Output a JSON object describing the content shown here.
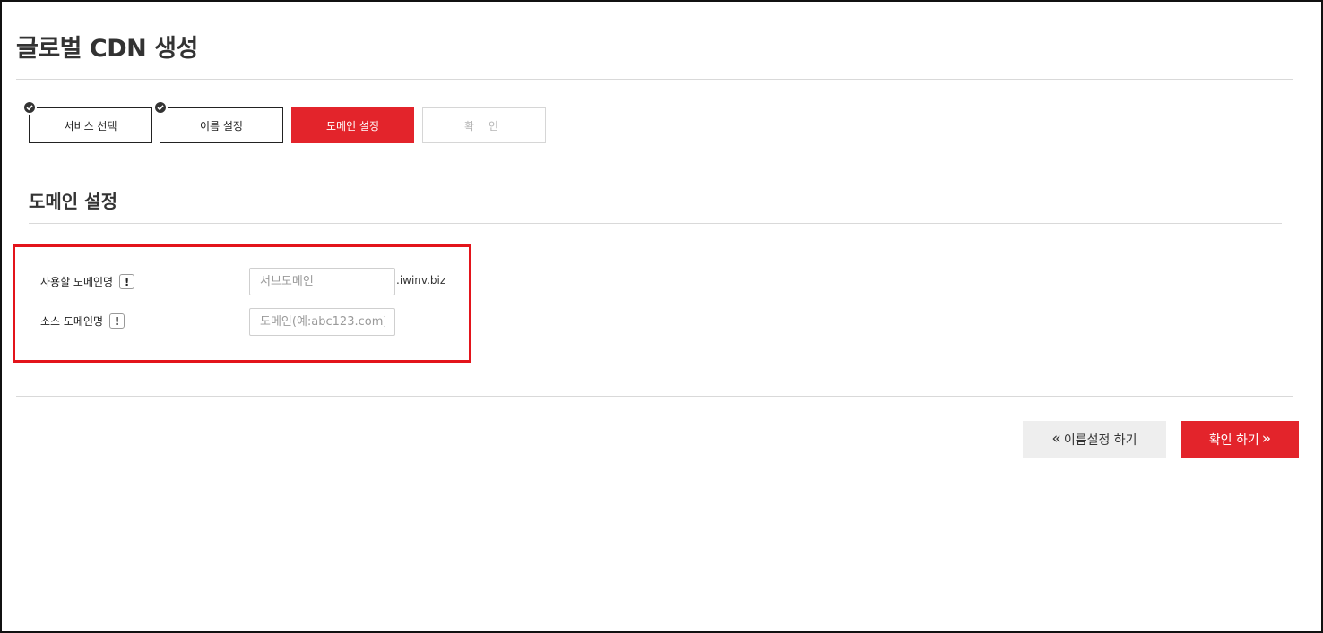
{
  "page": {
    "title": "글로벌 CDN 생성"
  },
  "steps": [
    {
      "label": "서비스 선택",
      "state": "done"
    },
    {
      "label": "이름 설정",
      "state": "done"
    },
    {
      "label": "도메인 설정",
      "state": "active"
    },
    {
      "label": "확 인",
      "state": "pending"
    }
  ],
  "section": {
    "title": "도메인 설정"
  },
  "form": {
    "domain_label": "사용할 도메인명",
    "domain_placeholder": "서브도메인",
    "domain_value": "",
    "domain_suffix": ".iwinv.biz",
    "source_label": "소스 도메인명",
    "source_placeholder": "도메인(예:abc123.com)",
    "source_value": "",
    "info_glyph": "!"
  },
  "actions": {
    "prev_label": "이름설정 하기",
    "next_label": "확인 하기",
    "prev_chevron": "«",
    "next_chevron": "»"
  },
  "colors": {
    "accent": "#e3242b",
    "highlight_border": "#e3141b",
    "secondary_button": "#eeeeee"
  }
}
